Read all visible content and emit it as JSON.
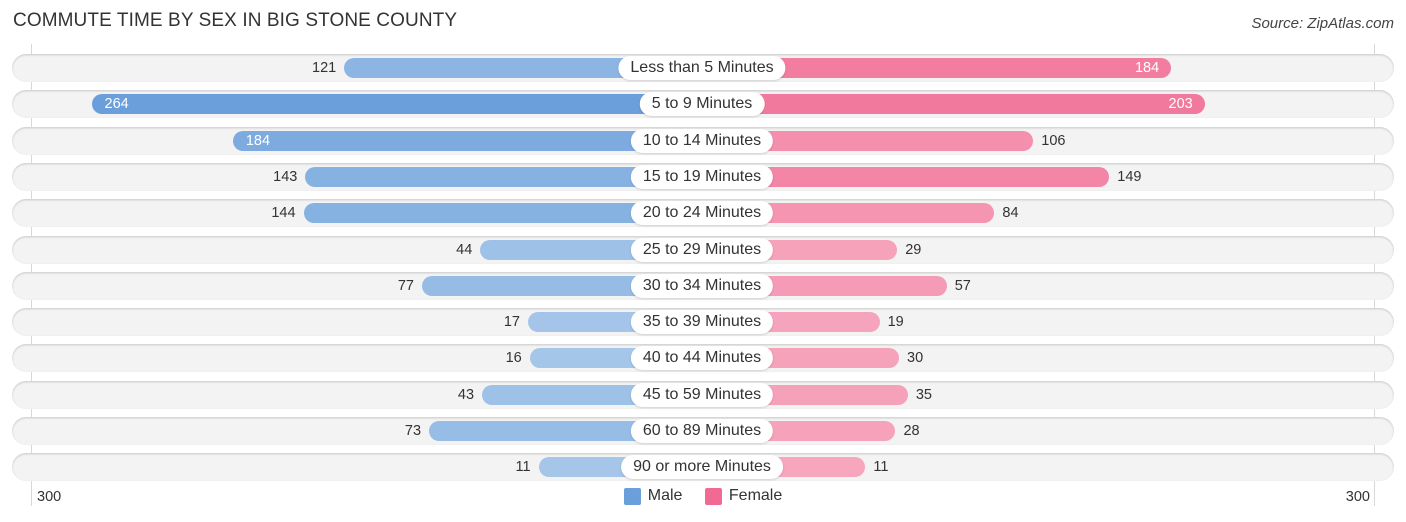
{
  "title": "COMMUTE TIME BY SEX IN BIG STONE COUNTY",
  "source": "Source: ZipAtlas.com",
  "colors": {
    "male": "#6a9fdc",
    "female": "#f06a94",
    "male_light": "#a8c8ea",
    "female_light": "#f7a9c0"
  },
  "chart_data": {
    "type": "bar",
    "orientation": "horizontal-diverging",
    "title": "COMMUTE TIME BY SEX IN BIG STONE COUNTY",
    "categories": [
      "Less than 5 Minutes",
      "5 to 9 Minutes",
      "10 to 14 Minutes",
      "15 to 19 Minutes",
      "20 to 24 Minutes",
      "25 to 29 Minutes",
      "30 to 34 Minutes",
      "35 to 39 Minutes",
      "40 to 44 Minutes",
      "45 to 59 Minutes",
      "60 to 89 Minutes",
      "90 or more Minutes"
    ],
    "series": [
      {
        "name": "Male",
        "side": "left",
        "values": [
          121,
          264,
          184,
          143,
          144,
          44,
          77,
          17,
          16,
          43,
          73,
          11
        ]
      },
      {
        "name": "Female",
        "side": "right",
        "values": [
          184,
          203,
          106,
          149,
          84,
          29,
          57,
          19,
          30,
          35,
          28,
          11
        ]
      }
    ],
    "axis": {
      "left_label": "300",
      "right_label": "300",
      "range": [
        0,
        300
      ]
    },
    "legend": {
      "position": "bottom-center",
      "entries": [
        "Male",
        "Female"
      ]
    }
  }
}
